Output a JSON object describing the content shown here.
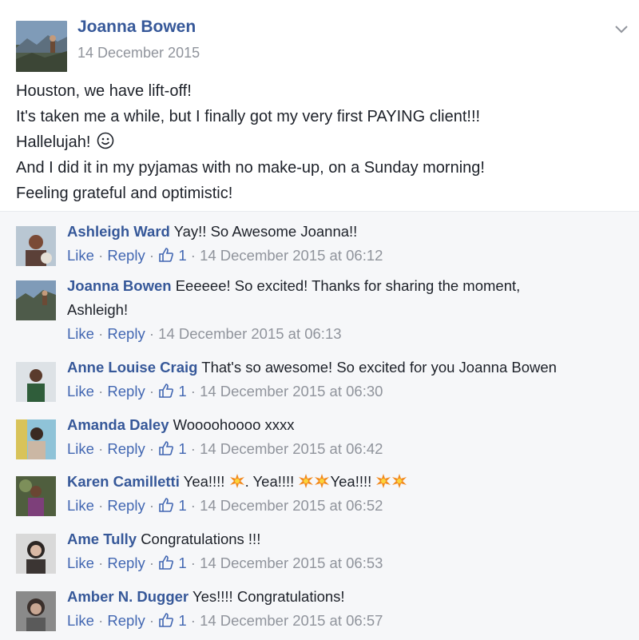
{
  "post": {
    "author": "Joanna Bowen",
    "date": "14 December 2015",
    "lines": [
      "Houston, we have lift-off!",
      "It's taken me a while, but I finally got my very first PAYING client!!!",
      "Hallelujah!",
      "And I did it in my pyjamas with no make-up, on a Sunday morning!",
      "Feeling grateful and optimistic!"
    ]
  },
  "comments": [
    {
      "name": "Ashleigh Ward",
      "text": "Yay!! So Awesome Joanna!!",
      "like": "Like",
      "reply": "Reply",
      "likes": "1",
      "time": "14 December 2015 at 06:12"
    },
    {
      "name": "Joanna Bowen",
      "text": "Eeeeee! So excited! Thanks for sharing the moment,",
      "text2": "Ashleigh!",
      "like": "Like",
      "reply": "Reply",
      "time": "14 December 2015 at 06:13"
    },
    {
      "name": "Anne Louise Craig",
      "text": "That's so awesome! So excited for you Joanna Bowen",
      "like": "Like",
      "reply": "Reply",
      "likes": "1",
      "time": "14 December 2015 at 06:30"
    },
    {
      "name": "Amanda Daley",
      "text": "Woooohoooo xxxx",
      "like": "Like",
      "reply": "Reply",
      "likes": "1",
      "time": "14 December 2015 at 06:42"
    },
    {
      "name": "Karen Camilletti",
      "text_a": "Yea!!!!",
      "text_b": ". Yea!!!!",
      "text_c": "Yea!!!!",
      "like": "Like",
      "reply": "Reply",
      "likes": "1",
      "time": "14 December 2015 at 06:52"
    },
    {
      "name": "Ame Tully",
      "text": "Congratulations !!!",
      "like": "Like",
      "reply": "Reply",
      "likes": "1",
      "time": "14 December 2015 at 06:53"
    },
    {
      "name": "Amber N. Dugger",
      "text": "Yes!!!! Congratulations!",
      "like": "Like",
      "reply": "Reply",
      "likes": "1",
      "time": "14 December 2015 at 06:57"
    }
  ],
  "colors": {
    "link": "#365899",
    "meta": "#90949c",
    "action": "#4267b2",
    "comments_bg": "#f6f7f9"
  },
  "icons": [
    "chevron-down-icon",
    "smiley-icon",
    "thumbs-up-icon",
    "burst-emoji-icon"
  ]
}
